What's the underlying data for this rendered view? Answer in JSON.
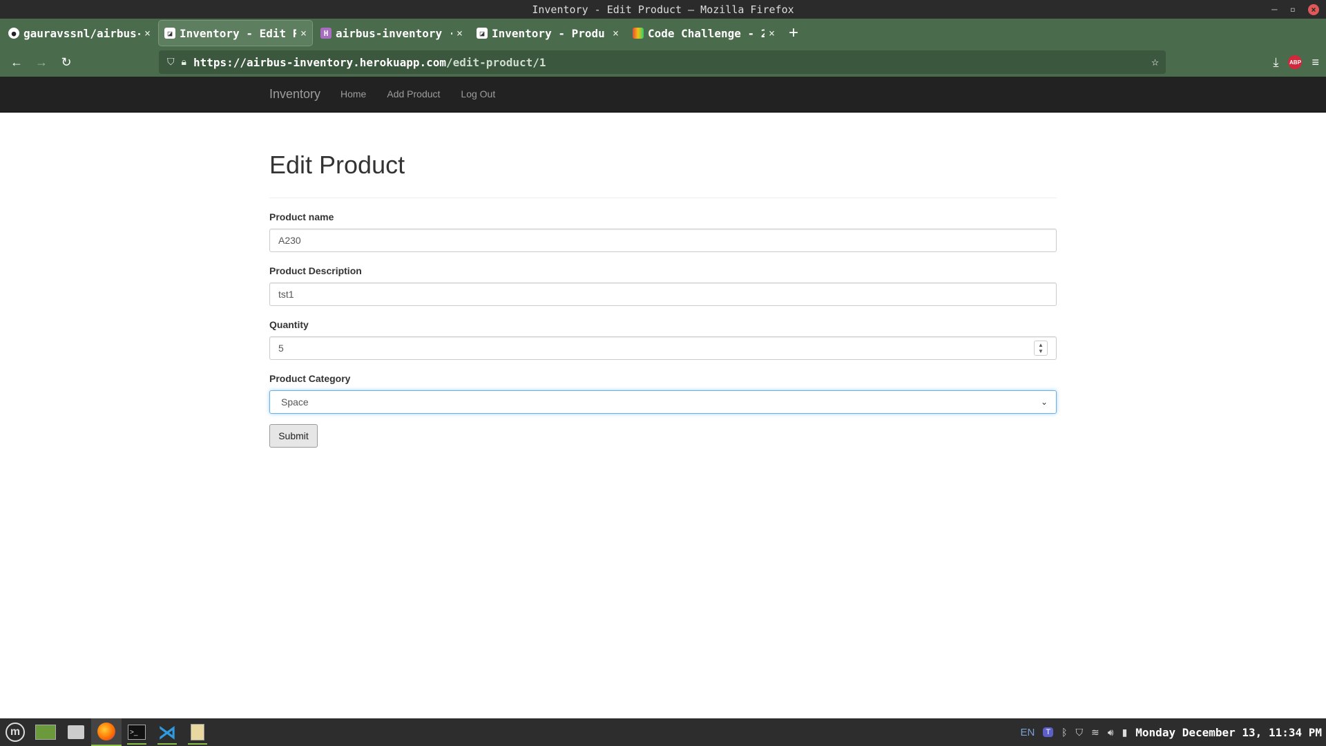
{
  "window": {
    "title": "Inventory - Edit Product — Mozilla Firefox"
  },
  "tabs": [
    {
      "label": "gauravssnl/airbus-",
      "icon": "github-icon",
      "active": false
    },
    {
      "label": "Inventory - Edit P",
      "icon": "page-icon",
      "active": true
    },
    {
      "label": "airbus-inventory ·",
      "icon": "heroku-icon",
      "active": false
    },
    {
      "label": "Inventory - Produ",
      "icon": "page-icon",
      "active": false
    },
    {
      "label": "Code Challenge - 2",
      "icon": "color-icon",
      "active": false
    }
  ],
  "urlbar": {
    "host": "https://airbus-inventory.herokuapp.com",
    "path": "/edit-product/1"
  },
  "site": {
    "brand": "Inventory",
    "links": [
      "Home",
      "Add Product",
      "Log Out"
    ]
  },
  "form": {
    "title": "Edit Product",
    "fields": {
      "name": {
        "label": "Product name",
        "value": "A230"
      },
      "description": {
        "label": "Product Description",
        "value": "tst1"
      },
      "quantity": {
        "label": "Quantity",
        "value": "5"
      },
      "category": {
        "label": "Product Category",
        "value": "Space"
      }
    },
    "submit_label": "Submit"
  },
  "taskbar": {
    "lang": "EN",
    "clock": "Monday December 13, 11:34 PM"
  }
}
